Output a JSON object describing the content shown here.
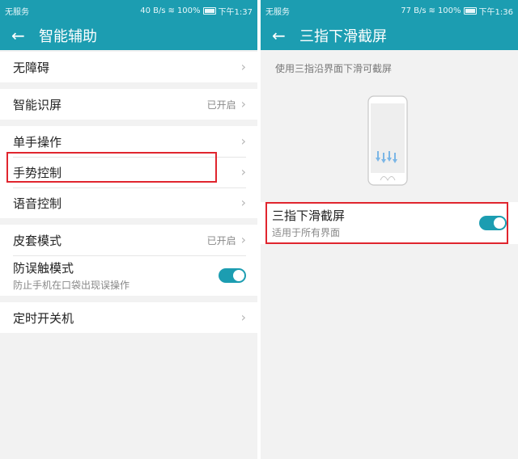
{
  "left": {
    "status": {
      "carrier": "无服务",
      "speed": "40 B/s",
      "battery": "100%",
      "time": "下午1:37"
    },
    "header": {
      "back_icon": "arrow-left-icon",
      "title": "智能辅助"
    },
    "items": [
      {
        "label": "无障碍",
        "value": ""
      },
      {
        "label": "智能识屏",
        "value": "已开启"
      },
      {
        "label": "单手操作",
        "value": ""
      },
      {
        "label": "手势控制",
        "value": ""
      },
      {
        "label": "语音控制",
        "value": ""
      },
      {
        "label": "皮套模式",
        "value": "已开启"
      },
      {
        "label": "防误触模式",
        "sub": "防止手机在口袋出现误操作",
        "toggle": true
      },
      {
        "label": "定时开关机",
        "value": ""
      }
    ]
  },
  "right": {
    "status": {
      "carrier": "无服务",
      "speed": "77 B/s",
      "battery": "100%",
      "time": "下午1:36"
    },
    "header": {
      "back_icon": "arrow-left-icon",
      "title": "三指下滑截屏"
    },
    "description": "使用三指沿界面下滑可截屏",
    "setting": {
      "label": "三指下滑截屏",
      "sub": "适用于所有界面",
      "toggle": true
    }
  },
  "colors": {
    "accent": "#1c9db1",
    "highlight": "#e0252e"
  }
}
